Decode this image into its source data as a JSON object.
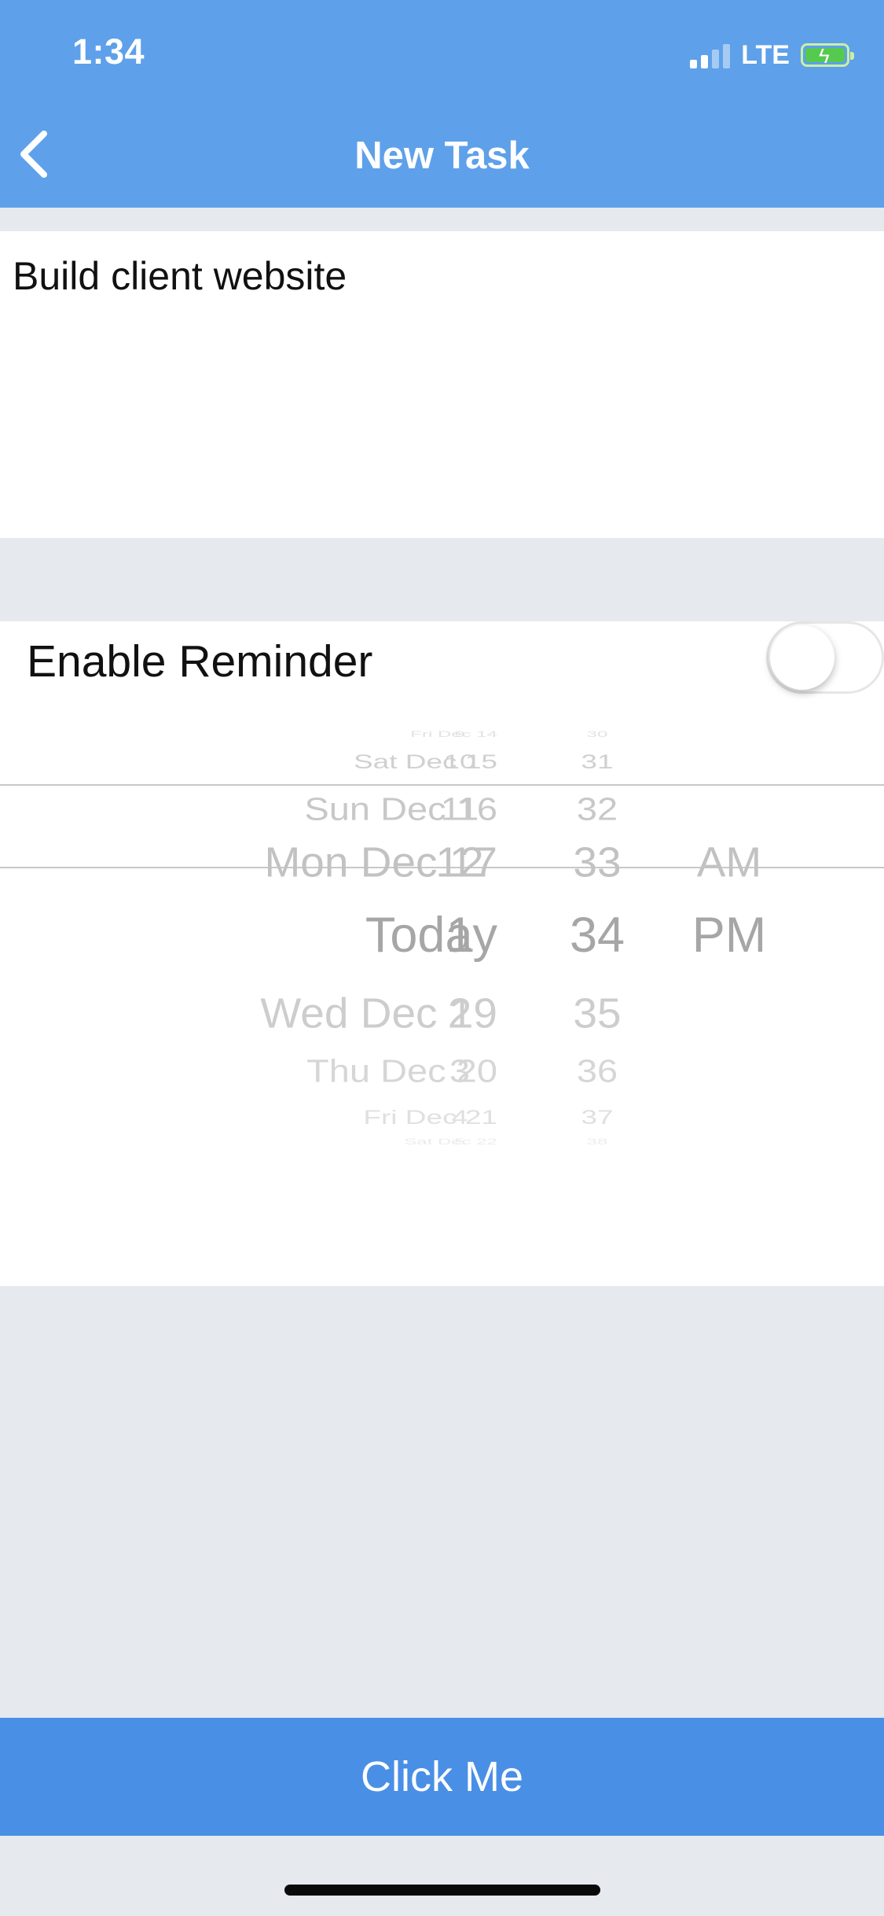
{
  "status_bar": {
    "time": "1:34",
    "network": "LTE"
  },
  "nav": {
    "title": "New Task"
  },
  "task": {
    "text": "Build client website"
  },
  "reminder": {
    "label": "Enable Reminder",
    "enabled": false
  },
  "picker": {
    "dates": [
      "Fri Dec 14",
      "Sat Dec 15",
      "Sun Dec 16",
      "Mon Dec 17",
      "Today",
      "Wed Dec 19",
      "Thu Dec 20",
      "Fri Dec 21",
      "Sat Dec 22"
    ],
    "hours": [
      "9",
      "10",
      "11",
      "12",
      "1",
      "2",
      "3",
      "4",
      "5"
    ],
    "minutes": [
      "30",
      "31",
      "32",
      "33",
      "34",
      "35",
      "36",
      "37",
      "38"
    ],
    "ampm": [
      "",
      "",
      "",
      "AM",
      "PM",
      "",
      "",
      "",
      ""
    ],
    "selected": {
      "date": "Today",
      "hour": "1",
      "minute": "34",
      "ampm": "PM"
    }
  },
  "button": {
    "label": "Click Me"
  },
  "colors": {
    "nav": "#5ea0ea",
    "button": "#4a8fe6",
    "background": "#e6e9ee"
  },
  "icons": {
    "back": "chevron-left-icon"
  }
}
